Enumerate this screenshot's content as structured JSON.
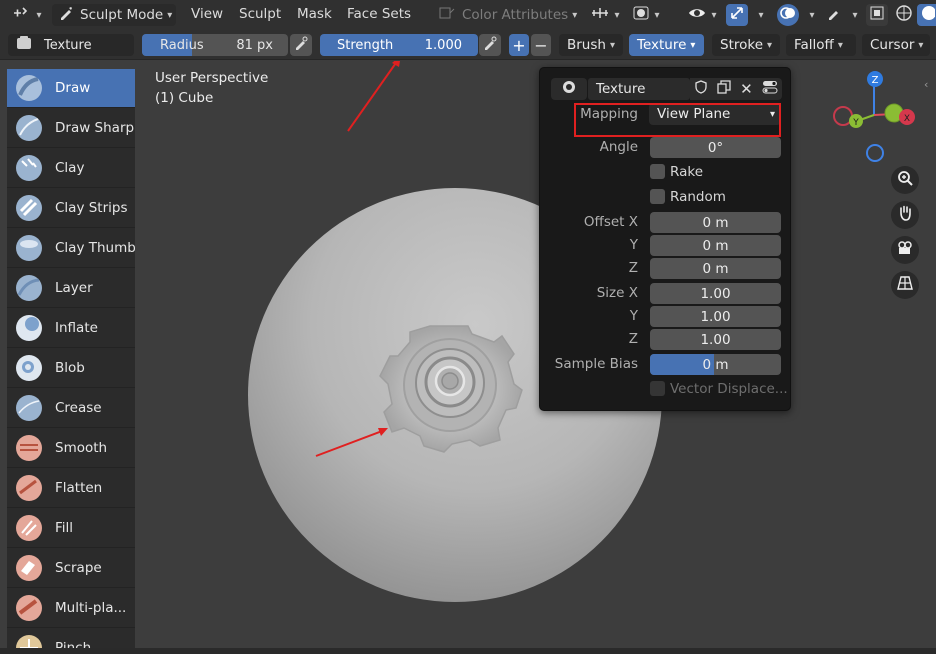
{
  "header": {
    "mode": "Sculpt Mode",
    "menus": [
      "View",
      "Sculpt",
      "Mask",
      "Face Sets"
    ],
    "color_attributes": "Color Attributes",
    "icons": [
      "editor-type-icon",
      "sculpt-mode-icon",
      "symmetry-icon",
      "shading-icon",
      "visibility-icon",
      "gizmo-icon",
      "overlay-icon",
      "xray-icon",
      "viewport-shading-icon"
    ]
  },
  "brush_bar": {
    "brush_name": "Texture",
    "radius_label": "Radius",
    "radius_value": "81 px",
    "strength_label": "Strength",
    "strength_value": "1.000",
    "menus": [
      "Brush",
      "Texture",
      "Stroke",
      "Falloff",
      "Cursor"
    ],
    "active_menu": "Texture"
  },
  "viewport": {
    "perspective": "User Perspective",
    "object": "(1) Cube"
  },
  "toolbar": {
    "tools": [
      {
        "label": "Draw",
        "active": true
      },
      {
        "label": "Draw Sharp"
      },
      {
        "label": "Clay"
      },
      {
        "label": "Clay Strips"
      },
      {
        "label": "Clay Thumb"
      },
      {
        "label": "Layer"
      },
      {
        "label": "Inflate"
      },
      {
        "label": "Blob"
      },
      {
        "label": "Crease"
      },
      {
        "label": "Smooth"
      },
      {
        "label": "Flatten"
      },
      {
        "label": "Fill"
      },
      {
        "label": "Scrape"
      },
      {
        "label": "Multi-pla..."
      },
      {
        "label": "Pinch"
      }
    ]
  },
  "texture_popover": {
    "texture_name": "Texture",
    "mapping_label": "Mapping",
    "mapping_value": "View Plane",
    "angle_label": "Angle",
    "angle_value": "0°",
    "rake_label": "Rake",
    "random_label": "Random",
    "offset_x_label": "Offset X",
    "offset_y_label": "Y",
    "offset_z_label": "Z",
    "offset_x": "0 m",
    "offset_y": "0 m",
    "offset_z": "0 m",
    "size_x_label": "Size X",
    "size_y_label": "Y",
    "size_z_label": "Z",
    "size_x": "1.00",
    "size_y": "1.00",
    "size_z": "1.00",
    "sample_bias_label": "Sample Bias",
    "sample_bias_value": "0 m",
    "vector_displacement_label": "Vector Displace..."
  },
  "gizmo": {
    "z_label": "Z",
    "y_label": "Y",
    "x_label": "X"
  },
  "colors": {
    "accent_blue": "#4772b3",
    "highlight_red": "#e02020",
    "axis_x": "#e04a5d",
    "axis_y": "#8bbd34",
    "axis_z": "#3f82e6"
  }
}
